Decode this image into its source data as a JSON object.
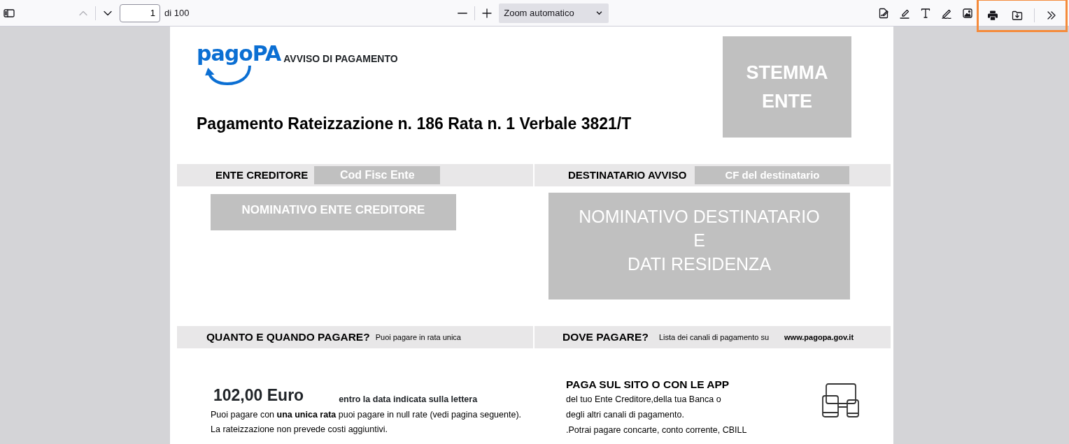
{
  "toolbar": {
    "left_tools": [
      {
        "kind": "sidebar"
      },
      {
        "kind": "prev",
        "disabled": true
      },
      {
        "kind": "next",
        "disabled": false
      }
    ],
    "page_input": {
      "value": "1"
    },
    "page_count": "di 100",
    "zoom_tools": [
      {
        "kind": "minus"
      },
      {
        "kind": "plus"
      }
    ],
    "zoom_select": {
      "value": "Zoom automatico"
    },
    "right_tools": [
      {
        "kind": "signature"
      },
      {
        "kind": "highlight"
      },
      {
        "kind": "text"
      },
      {
        "kind": "draw"
      },
      {
        "kind": "image"
      },
      {
        "kind": "print",
        "highlighted": true
      },
      {
        "kind": "save",
        "highlighted": true
      },
      {
        "kind": "more"
      }
    ]
  },
  "document": {
    "logo": "pagoPA",
    "heading": "AVVISO DI PAGAMENTO",
    "title": "Pagamento Rateizzazione n. 186 Rata n. 1 Verbale 3821/T",
    "stemma": [
      "STEMMA",
      "ENTE"
    ],
    "creditor": {
      "label": "ENTE CREDITORE",
      "code": "Cod Fisc Ente",
      "name": "NOMINATIVO ENTE CREDITORE"
    },
    "recipient": {
      "label": "DESTINATARIO AVVISO",
      "code": "CF del destinatario",
      "name": [
        "NOMINATIVO DESTINATARIO",
        "E",
        "DATI RESIDENZA"
      ]
    },
    "when": {
      "label": "QUANTO E QUANDO PAGARE?",
      "note": "Puoi pagare in rata unica",
      "amount": "102,00 Euro",
      "deadline": "entro la data indicata sulla lettera",
      "lines": [
        "Puoi pagare con **una unica rata** puoi pagare in null rate (vedi pagina seguente).",
        "La rateizzazione non prevede costi aggiuntivi."
      ]
    },
    "where": {
      "label": "DOVE PAGARE?",
      "note": "Lista dei canali di pagamento su",
      "site": "www.pagopa.gov.it",
      "channel_title": "PAGA SUL SITO O CON LE APP",
      "lines": [
        "del tuo Ente Creditore,della tua Banca o",
        "degli altri canali di pagamento.",
        ".Potrai pagare concarte, conto corrente, CBILL"
      ]
    }
  }
}
